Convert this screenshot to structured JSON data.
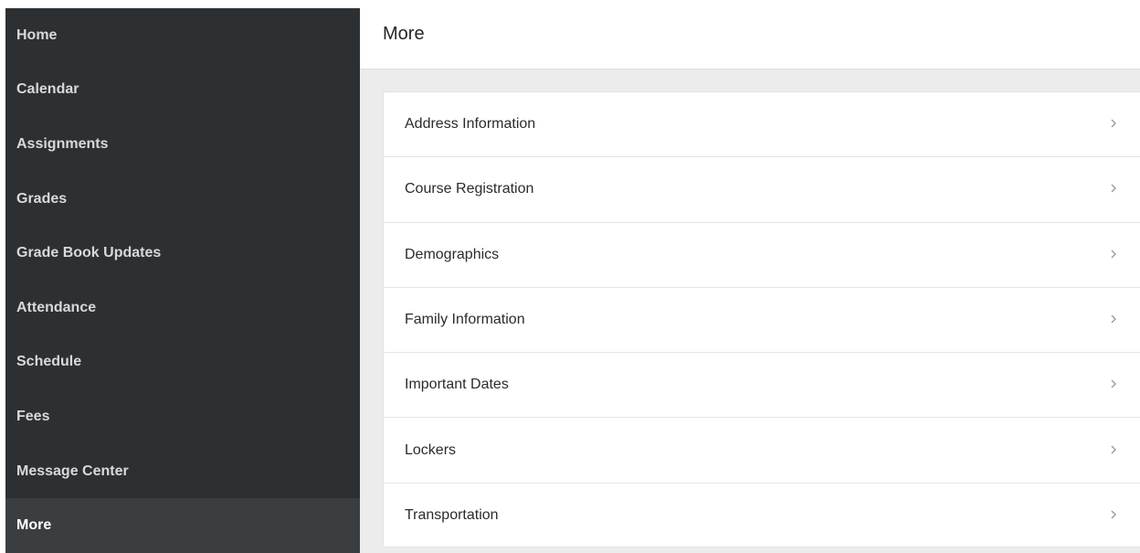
{
  "sidebar": {
    "items": [
      {
        "label": "Home"
      },
      {
        "label": "Calendar"
      },
      {
        "label": "Assignments"
      },
      {
        "label": "Grades"
      },
      {
        "label": "Grade Book Updates"
      },
      {
        "label": "Attendance"
      },
      {
        "label": "Schedule"
      },
      {
        "label": "Fees"
      },
      {
        "label": "Message Center"
      },
      {
        "label": "More",
        "active": true
      }
    ]
  },
  "header": {
    "title": "More"
  },
  "main": {
    "items": [
      {
        "label": "Address Information",
        "icon": "chevron-right-icon"
      },
      {
        "label": "Course Registration",
        "icon": "chevron-right-icon"
      },
      {
        "label": "Demographics",
        "icon": "chevron-right-icon"
      },
      {
        "label": "Family Information",
        "icon": "chevron-right-icon"
      },
      {
        "label": "Important Dates",
        "icon": "chevron-right-icon"
      },
      {
        "label": "Lockers",
        "icon": "chevron-right-icon"
      },
      {
        "label": "Transportation",
        "icon": "chevron-right-icon"
      }
    ]
  },
  "colors": {
    "sidebar_bg": "#2d3033",
    "sidebar_active_bg": "#3b3e41",
    "sidebar_text": "#d7d9db",
    "page_bg": "#ececec",
    "chevron": "#9a9a9a"
  }
}
